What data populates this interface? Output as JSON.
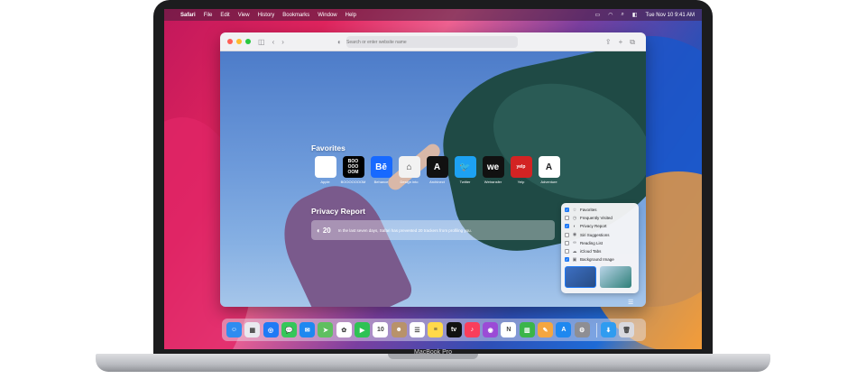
{
  "menubar": {
    "app": "Safari",
    "items": [
      "File",
      "Edit",
      "View",
      "History",
      "Bookmarks",
      "Window",
      "Help"
    ],
    "clock": "Tue Nov 10  9:41 AM"
  },
  "toolbar": {
    "search_placeholder": "Search or enter website name"
  },
  "favorites": {
    "title": "Favorites",
    "items": [
      {
        "label": "Apple",
        "glyph": "",
        "color": "#ffffff",
        "fg": "#1c1c1e"
      },
      {
        "label": "BOOOOOOOM",
        "glyph": "BOO OOO OOM",
        "color": "#000000",
        "fg": "#ffffff"
      },
      {
        "label": "Behance",
        "glyph": "Bē",
        "color": "#1769ff",
        "fg": "#ffffff"
      },
      {
        "label": "Design into",
        "glyph": "⌂",
        "color": "#f2f2f2",
        "fg": "#333333"
      },
      {
        "label": "Archinect",
        "glyph": "A",
        "color": "#111111",
        "fg": "#ffffff"
      },
      {
        "label": "Twitter",
        "glyph": "🐦",
        "color": "#1da1f2",
        "fg": "#ffffff"
      },
      {
        "label": "Wetransfer",
        "glyph": "we",
        "color": "#111111",
        "fg": "#ffffff"
      },
      {
        "label": "Yelp",
        "glyph": "yelp",
        "color": "#d32323",
        "fg": "#ffffff"
      },
      {
        "label": "Adventure",
        "glyph": "A",
        "color": "#ffffff",
        "fg": "#1c1c1e"
      }
    ]
  },
  "privacy": {
    "title": "Privacy Report",
    "count": "20",
    "text": "In the last seven days, Safari has prevented 20 trackers from profiling you."
  },
  "customize": {
    "options": [
      {
        "label": "Favorites",
        "checked": true,
        "icon": "☆"
      },
      {
        "label": "Frequently Visited",
        "checked": false,
        "icon": "◷"
      },
      {
        "label": "Privacy Report",
        "checked": true,
        "icon": "◐"
      },
      {
        "label": "Siri Suggestions",
        "checked": false,
        "icon": "◉"
      },
      {
        "label": "Reading List",
        "checked": false,
        "icon": "∞"
      },
      {
        "label": "iCloud Tabs",
        "checked": false,
        "icon": "☁"
      },
      {
        "label": "Background Image",
        "checked": true,
        "icon": "▣"
      }
    ]
  },
  "dock": {
    "apps": [
      {
        "name": "Finder",
        "color": "#2f8cf0",
        "glyph": "☺"
      },
      {
        "name": "Launchpad",
        "color": "#e9e9ef",
        "glyph": "▦"
      },
      {
        "name": "Safari",
        "color": "#1f7af5",
        "glyph": "◎"
      },
      {
        "name": "Messages",
        "color": "#34c759",
        "glyph": "💬"
      },
      {
        "name": "Mail",
        "color": "#1e88f0",
        "glyph": "✉"
      },
      {
        "name": "Maps",
        "color": "#5fbf5f",
        "glyph": "➤"
      },
      {
        "name": "Photos",
        "color": "#ffffff",
        "glyph": "✿"
      },
      {
        "name": "FaceTime",
        "color": "#2ec254",
        "glyph": "▶"
      },
      {
        "name": "Calendar",
        "color": "#ffffff",
        "glyph": "10"
      },
      {
        "name": "Contacts",
        "color": "#b8926a",
        "glyph": "☻"
      },
      {
        "name": "Reminders",
        "color": "#ffffff",
        "glyph": "☰"
      },
      {
        "name": "Notes",
        "color": "#ffd94a",
        "glyph": "≡"
      },
      {
        "name": "TV",
        "color": "#111111",
        "glyph": "tv"
      },
      {
        "name": "Music",
        "color": "#fa3e5c",
        "glyph": "♪"
      },
      {
        "name": "Podcasts",
        "color": "#9b4bd6",
        "glyph": "◉"
      },
      {
        "name": "News",
        "color": "#ffffff",
        "glyph": "N"
      },
      {
        "name": "Numbers",
        "color": "#3ab54a",
        "glyph": "▥"
      },
      {
        "name": "Pages",
        "color": "#f4a640",
        "glyph": "✎"
      },
      {
        "name": "App Store",
        "color": "#1e88f0",
        "glyph": "A"
      },
      {
        "name": "System Preferences",
        "color": "#8e8e93",
        "glyph": "⚙"
      },
      {
        "name": "Downloads",
        "color": "#2f9cf0",
        "glyph": "⬇"
      },
      {
        "name": "Trash",
        "color": "#d9d9de",
        "glyph": "🗑"
      }
    ]
  },
  "device": {
    "label": "MacBook Pro"
  }
}
